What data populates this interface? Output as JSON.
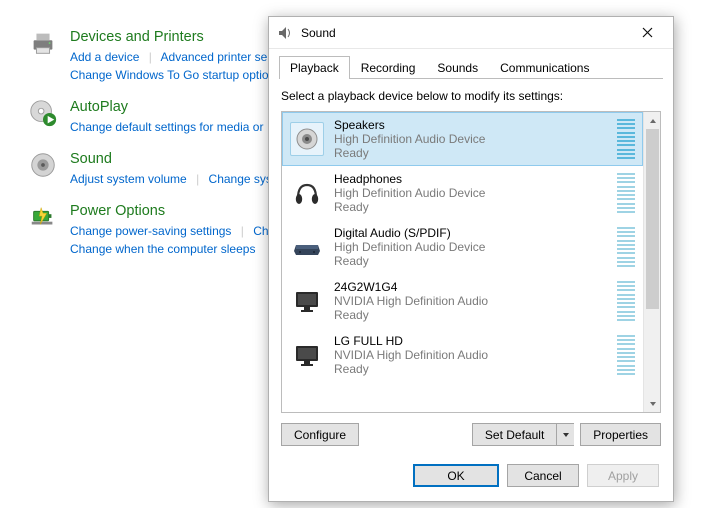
{
  "cp": {
    "items": [
      {
        "title": "Devices and Printers",
        "links": [
          "Add a device",
          "Advanced printer se",
          "Change Windows To Go startup optio"
        ]
      },
      {
        "title": "AutoPlay",
        "links": [
          "Change default settings for media or"
        ]
      },
      {
        "title": "Sound",
        "links": [
          "Adjust system volume",
          "Change sys"
        ]
      },
      {
        "title": "Power Options",
        "links": [
          "Change power-saving settings",
          "Ch",
          "Change when the computer sleeps"
        ]
      }
    ]
  },
  "dialog": {
    "title": "Sound",
    "tabs": [
      "Playback",
      "Recording",
      "Sounds",
      "Communications"
    ],
    "active_tab": 0,
    "prompt": "Select a playback device below to modify its settings:",
    "devices": [
      {
        "name": "Speakers",
        "sub1": "High Definition Audio Device",
        "sub2": "Ready",
        "icon": "speakers",
        "selected": true
      },
      {
        "name": "Headphones",
        "sub1": "High Definition Audio Device",
        "sub2": "Ready",
        "icon": "headphones",
        "selected": false
      },
      {
        "name": "Digital Audio (S/PDIF)",
        "sub1": "High Definition Audio Device",
        "sub2": "Ready",
        "icon": "spdif",
        "selected": false
      },
      {
        "name": "24G2W1G4",
        "sub1": "NVIDIA High Definition Audio",
        "sub2": "Ready",
        "icon": "monitor",
        "selected": false
      },
      {
        "name": "LG FULL HD",
        "sub1": "NVIDIA High Definition Audio",
        "sub2": "Ready",
        "icon": "monitor",
        "selected": false
      }
    ],
    "buttons": {
      "configure": "Configure",
      "set_default": "Set Default",
      "properties": "Properties",
      "ok": "OK",
      "cancel": "Cancel",
      "apply": "Apply"
    }
  }
}
